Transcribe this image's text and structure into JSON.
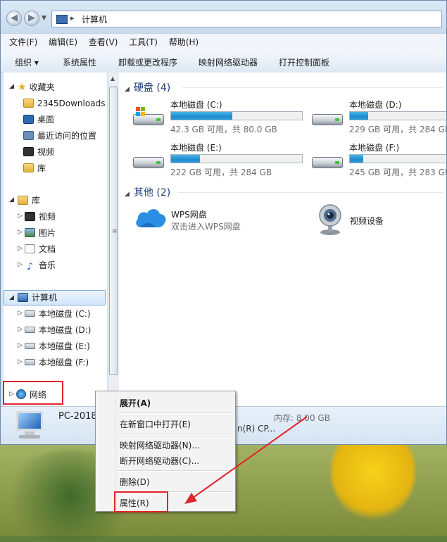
{
  "window": {
    "title": "计算机",
    "addr_separator": "▸"
  },
  "menubar": {
    "items": [
      "文件(F)",
      "编辑(E)",
      "查看(V)",
      "工具(T)",
      "帮助(H)"
    ]
  },
  "commandbar": {
    "organize": "组织 ▾",
    "system_properties": "系统属性",
    "uninstall": "卸载或更改程序",
    "map_drive": "映射网络驱动器",
    "control_panel": "打开控制面板"
  },
  "nav": {
    "favorites": "收藏夹",
    "fav_items": [
      "2345Downloads",
      "桌面",
      "最近访问的位置",
      "视频",
      "库"
    ],
    "libraries": "库",
    "lib_items": [
      "视频",
      "图片",
      "文档",
      "音乐"
    ],
    "computer": "计算机",
    "computer_items": [
      "本地磁盘 (C:)",
      "本地磁盘 (D:)",
      "本地磁盘 (E:)",
      "本地磁盘 (F:)"
    ],
    "network": "网络"
  },
  "content": {
    "hard_disks_header": "硬盘 (4)",
    "drives": [
      {
        "name": "本地磁盘 (C:)",
        "info": "42.3 GB 可用，共 80.0 GB",
        "used_fraction": 0.47
      },
      {
        "name": "本地磁盘 (D:)",
        "info": "229 GB 可用，共 284 GB",
        "used_fraction": 0.19
      },
      {
        "name": "本地磁盘 (E:)",
        "info": "222 GB 可用，共 284 GB",
        "used_fraction": 0.22
      },
      {
        "name": "本地磁盘 (F:)",
        "info": "245 GB 可用，共 283 GB",
        "used_fraction": 0.14
      }
    ],
    "other_header": "其他 (2)",
    "wps_name": "WPS网盘",
    "wps_sub": "双击进入WPS网盘",
    "video_device": "视频设备"
  },
  "details": {
    "pc_name": "PC-2018",
    "memory": "内存: 8.00 GB",
    "cpu_fragment": "n(R) CP..."
  },
  "context_menu": {
    "expand": "展开(A)",
    "open_new_window": "在新窗口中打开(E)",
    "map_drive": "映射网络驱动器(N)...",
    "disconnect_drive": "断开网络驱动器(C)...",
    "delete": "删除(D)",
    "properties": "属性(R)"
  },
  "colors": {
    "annotation": "#e0242b",
    "usage_bar": "#2a9bdc"
  }
}
